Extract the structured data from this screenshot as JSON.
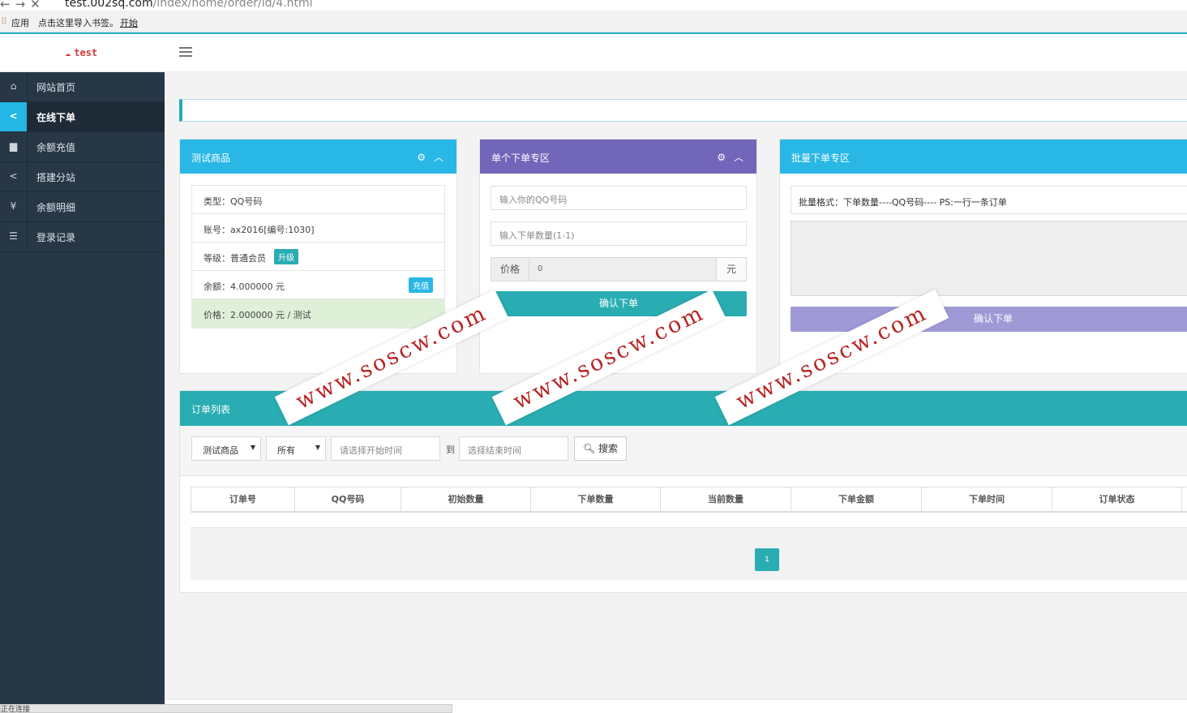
{
  "browser": {
    "url_host": "test.002sq.com",
    "url_path": "/index/home/order/id/4.html",
    "bookmarks": {
      "apps_label": "应用",
      "hint_text": "点击这里导入书签。",
      "start_link": "开始"
    },
    "status_text": "正在连接"
  },
  "header": {
    "logo_text": "test"
  },
  "sidebar": {
    "items": [
      {
        "label": "网站首页",
        "icon": "home-icon",
        "glyph": "⌂",
        "active": false
      },
      {
        "label": "在线下单",
        "icon": "share-icon",
        "glyph": "<",
        "active": true
      },
      {
        "label": "余额充值",
        "icon": "wallet-icon",
        "glyph": "▆",
        "active": false
      },
      {
        "label": "搭建分站",
        "icon": "share-alt-icon",
        "glyph": "<",
        "active": false
      },
      {
        "label": "余额明细",
        "icon": "yen-icon",
        "glyph": "¥",
        "active": false
      },
      {
        "label": "登录记录",
        "icon": "list-icon",
        "glyph": "☰",
        "active": false
      }
    ]
  },
  "product_panel": {
    "title": "测试商品",
    "type_line": "类型：QQ号码",
    "account_line": "账号：ax2016[编号:1030]",
    "level_line": "等级：普通会员",
    "upgrade_label": "升级",
    "balance_line": "余额：4.000000 元",
    "recharge_label": "充值",
    "price_line": "价格：2.000000 元 / 测试"
  },
  "single_panel": {
    "title": "单个下单专区",
    "qq_placeholder": "输入你的QQ号码",
    "qty_placeholder": "输入下单数量(1-1)",
    "price_label": "价格",
    "price_value": "0",
    "price_unit": "元",
    "confirm_label": "确认下单"
  },
  "batch_panel": {
    "title": "批量下单专区",
    "format_hint": "批量格式：下单数量----QQ号码---- PS:一行一条订单",
    "confirm_label": "确认下单"
  },
  "orders": {
    "title": "订单列表",
    "product_select": "测试商品",
    "status_select": "所有",
    "start_placeholder": "请选择开始时间",
    "to_label": "到",
    "end_placeholder": "选择结束时间",
    "search_label": "搜索",
    "columns": [
      "订单号",
      "QQ号码",
      "初始数量",
      "下单数量",
      "当前数量",
      "下单金额",
      "下单时间",
      "订单状态"
    ],
    "page": "1"
  },
  "watermark": {
    "text": "www.soscw.com"
  },
  "colors": {
    "teal": "#29adb2",
    "blue": "#29b7e5",
    "purple": "#7266ba",
    "sidebar": "#273746"
  }
}
